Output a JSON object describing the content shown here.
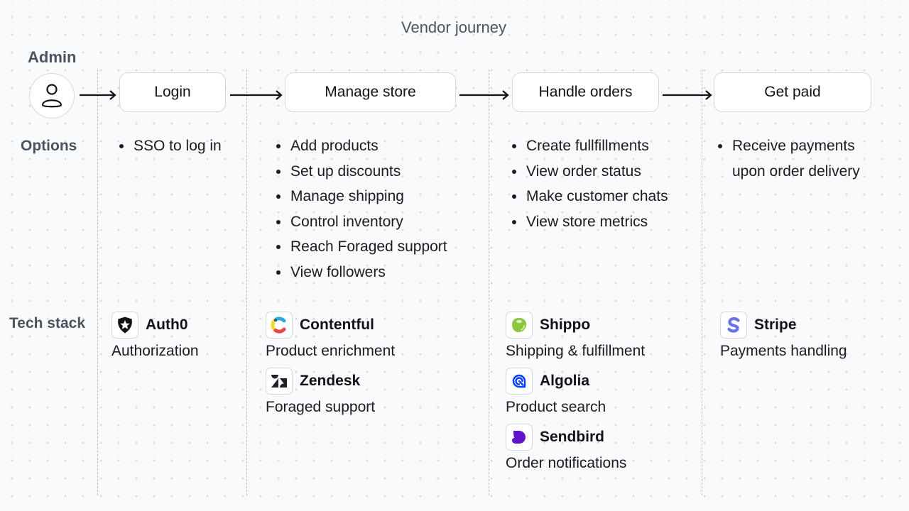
{
  "title": "Vendor journey",
  "actor": {
    "label": "Admin",
    "icon": "user-icon"
  },
  "row_labels": {
    "options": "Options",
    "tech_stack": "Tech stack"
  },
  "steps": [
    {
      "label": "Login",
      "options": [
        "SSO to log in"
      ],
      "tech": [
        {
          "name": "Auth0",
          "description": "Authorization",
          "icon": "auth0-logo-icon"
        }
      ]
    },
    {
      "label": "Manage store",
      "options": [
        "Add products",
        "Set up discounts",
        "Manage shipping",
        "Control inventory",
        "Reach Foraged support",
        "View followers"
      ],
      "tech": [
        {
          "name": "Contentful",
          "description": "Product enrichment",
          "icon": "contentful-logo-icon"
        },
        {
          "name": "Zendesk",
          "description": "Foraged support",
          "icon": "zendesk-logo-icon"
        }
      ]
    },
    {
      "label": "Handle orders",
      "options": [
        "Create fullfillments",
        "View order status",
        "Make customer chats",
        "View store metrics"
      ],
      "tech": [
        {
          "name": "Shippo",
          "description": "Shipping & fulfillment",
          "icon": "shippo-logo-icon"
        },
        {
          "name": "Algolia",
          "description": "Product search",
          "icon": "algolia-logo-icon"
        },
        {
          "name": "Sendbird",
          "description": "Order notifications",
          "icon": "sendbird-logo-icon"
        }
      ]
    },
    {
      "label": "Get paid",
      "options": [
        "Receive payments upon order delivery"
      ],
      "tech": [
        {
          "name": "Stripe",
          "description": "Payments handling",
          "icon": "stripe-logo-icon"
        }
      ]
    }
  ],
  "colors": {
    "background": "#f9fafb",
    "label_gray": "#4b5260",
    "stripe": "#6772e5",
    "algolia": "#003dff",
    "sendbird": "#6210cc",
    "shippo": "#8cc640"
  }
}
